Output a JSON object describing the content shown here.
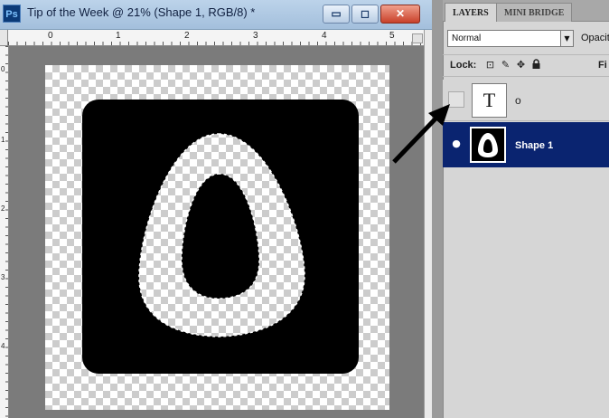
{
  "document": {
    "title": "Tip of the Week @ 21% (Shape 1, RGB/8) *",
    "app_icon_label": "Ps",
    "window_buttons": {
      "minimize": "▭",
      "maximize": "◻",
      "close": "✕"
    },
    "ruler_top_marks": [
      "0",
      "1",
      "2",
      "3",
      "4",
      "5"
    ],
    "ruler_left_marks": [
      "0",
      "1",
      "2",
      "3",
      "4"
    ]
  },
  "layers_panel": {
    "tabs": [
      {
        "label": "LAYERS"
      },
      {
        "label": "MINI BRIDGE"
      }
    ],
    "blend_mode": "Normal",
    "opacity_label": "Opacity",
    "lock_label": "Lock:",
    "fill_label": "Fi",
    "lock_icons": [
      "transparent-pixels-lock-icon",
      "brush-lock-icon",
      "move-lock-icon",
      "padlock-icon"
    ],
    "layers": [
      {
        "name": "o",
        "thumb_glyph": "T",
        "visible": false,
        "selected": false
      },
      {
        "name": "Shape 1",
        "visible": true,
        "selected": true
      }
    ]
  },
  "colors": {
    "selected_layer": "#0a2470",
    "shape_fill": "#000000"
  }
}
